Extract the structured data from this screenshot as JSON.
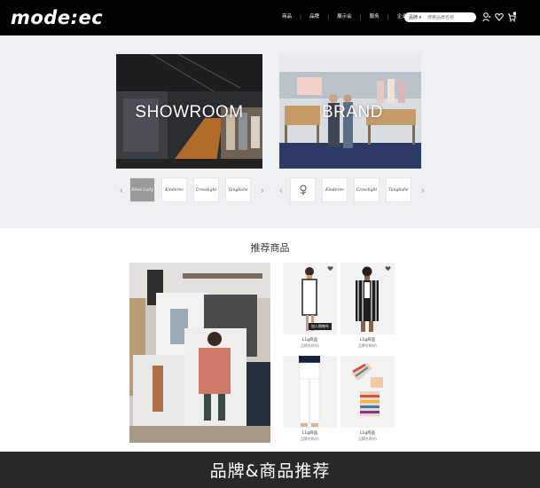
{
  "header": {
    "logo": "mode:ec",
    "nav": [
      "商品",
      "品牌",
      "展示会",
      "服务",
      "企业风采"
    ],
    "search_scope": "品牌 ▾",
    "search_placeholder": "搜索品牌名称",
    "icons": [
      "user-icon",
      "heart-icon",
      "cart-icon"
    ]
  },
  "showroom": {
    "cards": [
      {
        "label": "SHOWROOM"
      },
      {
        "label": "BRAND"
      }
    ],
    "left_brands": [
      "Bless Lady",
      "Kinderoo",
      "Crosslight",
      "Tangbuhe"
    ],
    "right_brands": [
      "",
      "Kinderoo",
      "Crosslight",
      "Tangbuhe"
    ]
  },
  "recommend": {
    "title": "推荐商品",
    "products": [
      {
        "name": "L1g商品",
        "desc": "品牌名称/价",
        "tag": "加入购物车"
      },
      {
        "name": "L1g商品",
        "desc": "品牌名称/价",
        "tag": ""
      },
      {
        "name": "L1g商品",
        "desc": "品牌名称/价",
        "tag": ""
      },
      {
        "name": "L1g商品",
        "desc": "品牌名称/价",
        "tag": ""
      }
    ]
  },
  "subtitle": "品牌&商品推荐",
  "colors": {
    "header_bg": "#000000",
    "showroom_bg": "#eef0f4",
    "subtitle_bg": "#0a0a0a"
  }
}
